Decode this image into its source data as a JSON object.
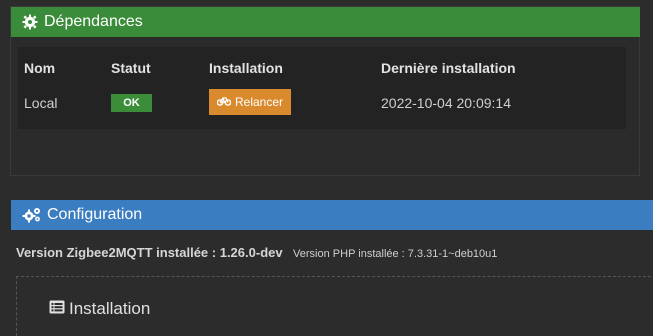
{
  "dependencies": {
    "title": "Dépendances",
    "header_color": "#3b8c3a",
    "icon": "gear-icon",
    "columns": [
      "Nom",
      "Statut",
      "Installation",
      "Dernière installation"
    ],
    "row": {
      "name": "Local",
      "status": "OK",
      "action_label": "Relancer",
      "action_icon": "bicycle-icon",
      "last_install": "2022-10-04 20:09:14"
    }
  },
  "configuration": {
    "title": "Configuration",
    "header_color": "#3a7dc0",
    "icon": "gears-icon",
    "version_main": "Version Zigbee2MQTT installée : 1.26.0-dev",
    "version_php": "Version PHP installée : 7.3.31-1~deb10u1",
    "install_section_title": "Installation",
    "install_icon": "list-icon"
  }
}
